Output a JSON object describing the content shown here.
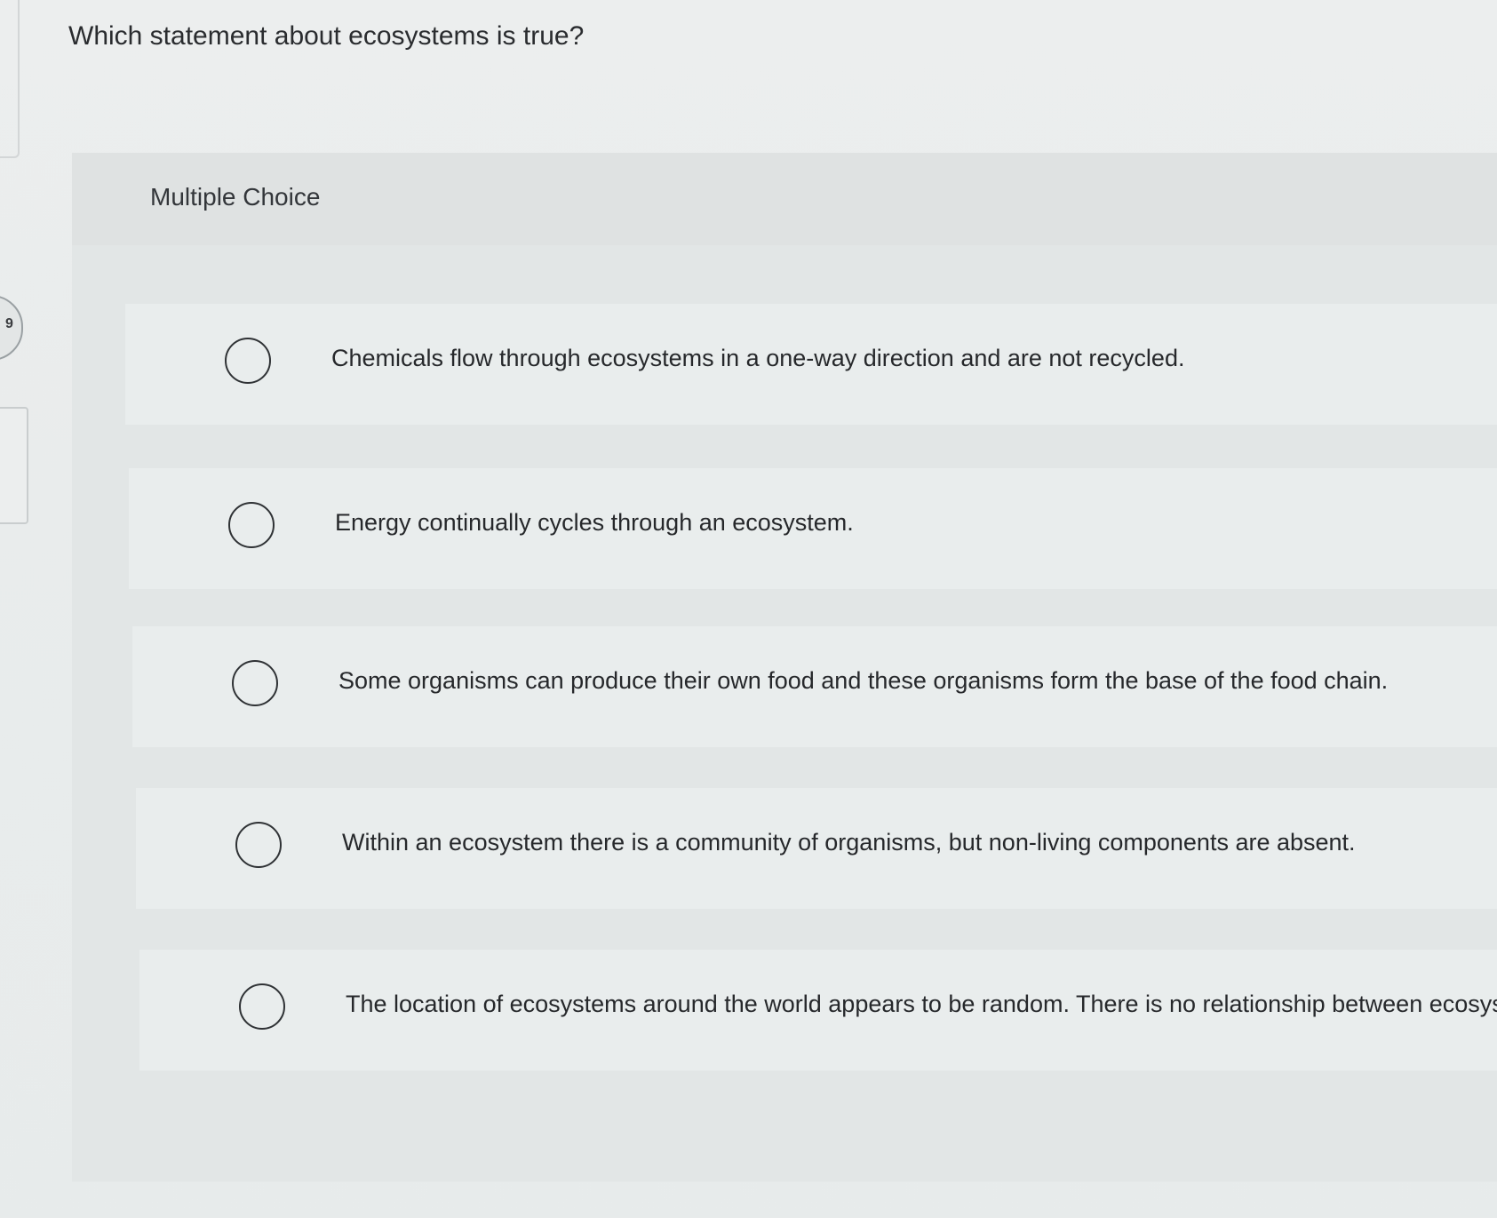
{
  "side_tab": {
    "number": "9"
  },
  "question": {
    "text": "Which statement about ecosystems is true?"
  },
  "panel": {
    "type_label": "Multiple Choice"
  },
  "options": [
    {
      "text": "Chemicals flow through ecosystems in a one-way direction and are not recycled.",
      "selected": false
    },
    {
      "text": "Energy continually cycles through an ecosystem.",
      "selected": false
    },
    {
      "text": "Some organisms can produce their own food and these organisms form the base of the food chain.",
      "selected": false
    },
    {
      "text": "Within an ecosystem there is a community of organisms, but non-living components are absent.",
      "selected": false
    },
    {
      "text": "The location of ecosystems around the world appears to be random. There is no relationship between ecosyste",
      "selected": false
    }
  ]
}
